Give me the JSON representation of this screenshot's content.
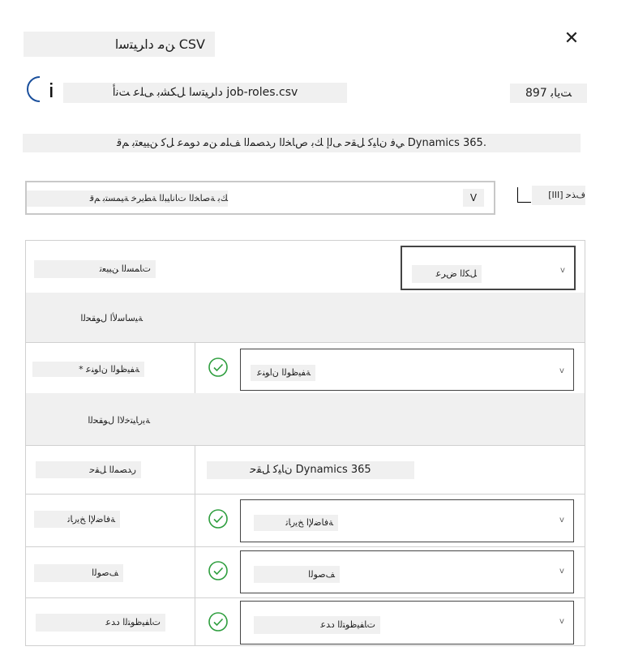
{
  "dialog": {
    "title": "ﻦﻣ ﺩﺍﺮﻴﺘﺳﺍ CSV",
    "close_glyph": "✕"
  },
  "file": {
    "label": "ﺩﺍﺮﻴﺘﺳﺍ ﻞﻜﺸﺑ ﻰﻠﻋ ﺖﻧﺃ job-roles.csv",
    "count": "ﺖﻳﺎﺑ 897"
  },
  "description": "ﻲﻓ ﻥﺎﻴﻛ ﻞﻘﺣ ﻰﻟﺇ ﻚﺑ ﺹﺎﺨﻟﺍ ﺭﺪﺼﻤﻟﺍ ﻒﻠﻣ ﻦﻣ ﺩﻮﻤﻋ ﻞﻛ ﻦﻴﻴﻌﺘﺑ ﻢﻗ Dynamics 365.",
  "mapping_select": {
    "value": "ﻚﺑ ﺔﺻﺎﺨﻟﺍ ﺕﺎﻧﺎﻴﺒﻟﺍ ﺔﻄﻳﺮﺧ ﺔﻴﻤﺴﺘﺑ ﻢﻗ",
    "chevron": "V"
  },
  "delete_option": {
    "box_glyph": "",
    "label": "[III] ﻑﺬﺣ"
  },
  "table": {
    "assignments_label": "ﺕﺎﻤﺴﻟﺍ ﻦﻴﻴﻌﺗ",
    "show_all_select": "ﻞﻜﻟﺍ ﺽﺮﻋ",
    "primary_section": "ﺔﻴﺳﺎﺳﻷﺍ ﻝﻮﻘﺤﻟﺍ",
    "job_title_label": "* ﺔﻔﻴﻇﻮﻟﺍ ﻥﺍﻮﻨﻋ",
    "job_title_select": "ﺔﻔﻴﻇﻮﻟﺍ ﻥﺍﻮﻨﻋ",
    "optional_section": "ﺔﻳﺭﺎﻴﺘﺧﻻﺍ ﻝﻮﻘﺤﻟﺍ",
    "source_field_label": "ﺭﺪﺼﻤﻟﺍ ﻞﻘﺣ",
    "dynamics_field_label": "ﻥﺎﻴﻛ ﻞﻘﺣ Dynamics 365",
    "created_label": "ﺔﻓﺎﺿﻹﺍ ﺦﻳﺭﺎﺗ",
    "created_select": "ﺔﻓﺎﺿﻹﺍ ﺦﻳﺭﺎﺗ",
    "desc_label": "ﻒﺻﻮﻟﺍ",
    "desc_select": "ﻒﺻﻮﻟﺍ",
    "jobs_label": "ﺕﺎﻔﻴﻇﻮﺘﻟﺍ ﺩﺪﻋ",
    "jobs_select": "ﺕﺎﻔﻴﻇﻮﺘﻟﺍ ﺩﺪﻋ",
    "chevron": "v"
  },
  "colors": {
    "accent_blue": "#1a4f9c",
    "success_green": "#2e9e3e"
  }
}
